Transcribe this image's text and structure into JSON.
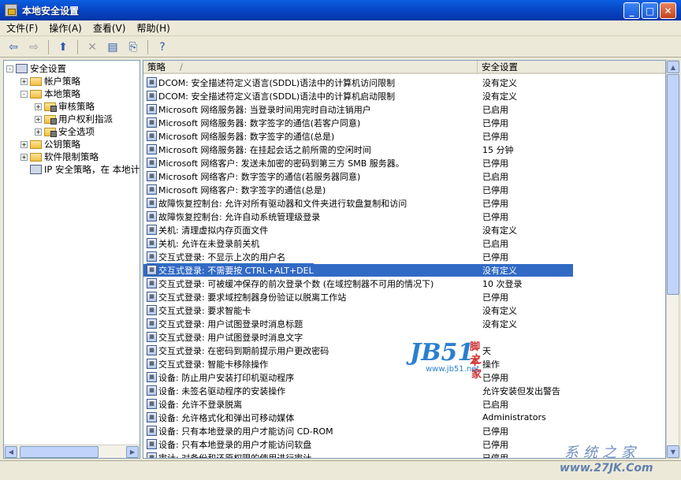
{
  "window": {
    "title": "本地安全设置"
  },
  "menu": [
    "文件(F)",
    "操作(A)",
    "查看(V)",
    "帮助(H)"
  ],
  "toolbar": [
    {
      "icon": "back-arrow-icon",
      "glyph": "⇦",
      "disabled": false
    },
    {
      "icon": "forward-arrow-icon",
      "glyph": "⇨",
      "disabled": true
    },
    {
      "icon": "up-folder-icon",
      "glyph": "⬆",
      "disabled": false
    },
    {
      "icon": "delete-icon",
      "glyph": "✕",
      "disabled": true
    },
    {
      "icon": "properties-icon",
      "glyph": "▤",
      "disabled": false
    },
    {
      "icon": "export-list-icon",
      "glyph": "⎘",
      "disabled": false
    },
    {
      "icon": "help-icon",
      "glyph": "?",
      "disabled": false
    }
  ],
  "tree": [
    {
      "label": "安全设置",
      "depth": 0,
      "expander": "-",
      "icon": "pc"
    },
    {
      "label": "帐户策略",
      "depth": 1,
      "expander": "+",
      "icon": "folder"
    },
    {
      "label": "本地策略",
      "depth": 1,
      "expander": "-",
      "icon": "folder"
    },
    {
      "label": "审核策略",
      "depth": 2,
      "expander": "+",
      "icon": "folder-lock"
    },
    {
      "label": "用户权利指派",
      "depth": 2,
      "expander": "+",
      "icon": "folder-lock"
    },
    {
      "label": "安全选项",
      "depth": 2,
      "expander": "+",
      "icon": "folder-lock"
    },
    {
      "label": "公钥策略",
      "depth": 1,
      "expander": "+",
      "icon": "folder"
    },
    {
      "label": "软件限制策略",
      "depth": 1,
      "expander": "+",
      "icon": "folder"
    },
    {
      "label": "IP 安全策略，在 本地计",
      "depth": 1,
      "expander": "",
      "icon": "pc"
    }
  ],
  "columns": {
    "policy": "策略",
    "setting": "安全设置"
  },
  "rows": [
    {
      "policy": "DCOM: 安全描述符定义语言(SDDL)语法中的计算机访问限制",
      "setting": "没有定义"
    },
    {
      "policy": "DCOM: 安全描述符定义语言(SDDL)语法中的计算机启动限制",
      "setting": "没有定义"
    },
    {
      "policy": "Microsoft 网络服务器: 当登录时间用完时自动注销用户",
      "setting": "已启用"
    },
    {
      "policy": "Microsoft 网络服务器: 数字签字的通信(若客户同意)",
      "setting": "已停用"
    },
    {
      "policy": "Microsoft 网络服务器: 数字签字的通信(总是)",
      "setting": "已停用"
    },
    {
      "policy": "Microsoft 网络服务器: 在挂起会话之前所需的空闲时间",
      "setting": "15 分钟"
    },
    {
      "policy": "Microsoft 网络客户: 发送未加密的密码到第三方 SMB 服务器。",
      "setting": "已停用"
    },
    {
      "policy": "Microsoft 网络客户: 数字签字的通信(若服务器同意)",
      "setting": "已启用"
    },
    {
      "policy": "Microsoft 网络客户: 数字签字的通信(总是)",
      "setting": "已停用"
    },
    {
      "policy": "故障恢复控制台: 允许对所有驱动器和文件夹进行软盘复制和访问",
      "setting": "已停用"
    },
    {
      "policy": "故障恢复控制台: 允许自动系统管理级登录",
      "setting": "已停用"
    },
    {
      "policy": "关机: 清理虚拟内存页面文件",
      "setting": "没有定义"
    },
    {
      "policy": "关机: 允许在未登录前关机",
      "setting": "已启用"
    },
    {
      "policy": "交互式登录: 不显示上次的用户名",
      "setting": "已停用"
    },
    {
      "policy": "交互式登录: 不需要按 CTRL+ALT+DEL",
      "setting": "没有定义",
      "selected": true
    },
    {
      "policy": "交互式登录: 可被缓冲保存的前次登录个数 (在域控制器不可用的情况下)",
      "setting": "10 次登录"
    },
    {
      "policy": "交互式登录: 要求域控制器身份验证以脱离工作站",
      "setting": "已停用"
    },
    {
      "policy": "交互式登录: 要求智能卡",
      "setting": "没有定义"
    },
    {
      "policy": "交互式登录: 用户试图登录时消息标题",
      "setting": "没有定义"
    },
    {
      "policy": "交互式登录: 用户试图登录时消息文字",
      "setting": ""
    },
    {
      "policy": "交互式登录: 在密码到期前提示用户更改密码",
      "setting": "天"
    },
    {
      "policy": "交互式登录: 智能卡移除操作",
      "setting": "操作"
    },
    {
      "policy": "设备: 防止用户安装打印机驱动程序",
      "setting": "已停用"
    },
    {
      "policy": "设备: 未签名驱动程序的安装操作",
      "setting": "允许安装但发出警告"
    },
    {
      "policy": "设备: 允许不登录脱离",
      "setting": "已启用"
    },
    {
      "policy": "设备: 允许格式化和弹出可移动媒体",
      "setting": "Administrators"
    },
    {
      "policy": "设备: 只有本地登录的用户才能访问 CD-ROM",
      "setting": "已停用"
    },
    {
      "policy": "设备: 只有本地登录的用户才能访问软盘",
      "setting": "已停用"
    },
    {
      "policy": "审计: 对备份和还原权限的使用进行审计",
      "setting": "已停用"
    }
  ],
  "watermark": {
    "logo": "JB51",
    "top_right": "脚本",
    "bottom_right": "之家",
    "url": "www.jb51.net",
    "site_cn": "系统之家",
    "site_url": "www.27JK.Com"
  }
}
